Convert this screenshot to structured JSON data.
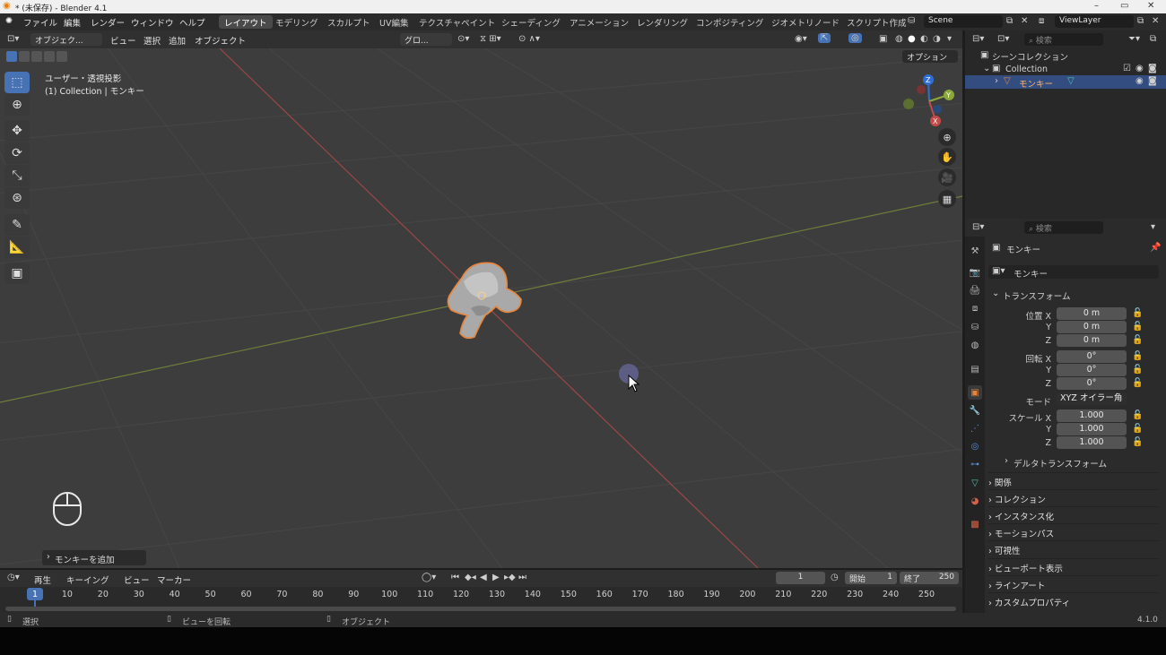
{
  "window": {
    "title": "* (未保存) - Blender 4.1",
    "minimize": "–",
    "maximize": "▭",
    "close": "✕"
  },
  "menu": [
    "ファイル",
    "編集",
    "レンダー",
    "ウィンドウ",
    "ヘルプ"
  ],
  "workspaces": [
    "レイアウト",
    "モデリング",
    "スカルプト",
    "UV編集",
    "テクスチャペイント",
    "シェーディング",
    "アニメーション",
    "レンダリング",
    "コンポジティング",
    "ジオメトリノード",
    "スクリプト作成"
  ],
  "active_workspace": "レイアウト",
  "scene": {
    "name": "Scene",
    "view_layer": "ViewLayer"
  },
  "viewport_header": {
    "mode": "オブジェク...",
    "menus": [
      "ビュー",
      "選択",
      "追加",
      "オブジェクト"
    ],
    "transform": "グロ...",
    "options": "オプション"
  },
  "viewport": {
    "view_name": "ユーザー・透視投影",
    "context": "(1) Collection | モンキー",
    "last_op": "モンキーを追加",
    "axis_x": "X",
    "axis_y": "Y",
    "axis_z": "Z"
  },
  "outliner": {
    "search_placeholder": "検索",
    "scene_collection": "シーンコレクション",
    "collection": "Collection",
    "object": "モンキー"
  },
  "properties": {
    "search_placeholder": "検索",
    "object_name": "モンキー",
    "datablock": "モンキー",
    "transform_title": "トランスフォーム",
    "location": {
      "label": "位置 X",
      "x": "0 m",
      "y": "0 m",
      "z": "0 m"
    },
    "rotation": {
      "label": "回転 X",
      "x": "0°",
      "y": "0°",
      "z": "0°"
    },
    "mode": {
      "label": "モード",
      "value": "XYZ オイラー角"
    },
    "scale": {
      "label": "スケール X",
      "x": "1.000",
      "y": "1.000",
      "z": "1.000"
    },
    "y": "Y",
    "z": "Z",
    "delta": "デルタトランスフォーム",
    "panels": [
      "関係",
      "コレクション",
      "インスタンス化",
      "モーションパス",
      "可視性",
      "ビューポート表示",
      "ラインアート",
      "カスタムプロパティ"
    ]
  },
  "timeline": {
    "menus": [
      "再生",
      "キーイング",
      "ビュー",
      "マーカー"
    ],
    "current_frame": "1",
    "start_label": "開始",
    "start": "1",
    "end_label": "終了",
    "end": "250",
    "ticks": [
      "1",
      "10",
      "20",
      "30",
      "40",
      "50",
      "60",
      "70",
      "80",
      "90",
      "100",
      "110",
      "120",
      "130",
      "140",
      "150",
      "160",
      "170",
      "180",
      "190",
      "200",
      "210",
      "220",
      "230",
      "240",
      "250"
    ]
  },
  "status": {
    "select": "選択",
    "rotate_view": "ビューを回転",
    "object": "オブジェクト",
    "version": "4.1.0"
  },
  "colors": {
    "accent": "#4772b3",
    "selection": "#e8853a",
    "x_axis": "#c54a4a",
    "y_axis": "#8ba93a"
  }
}
